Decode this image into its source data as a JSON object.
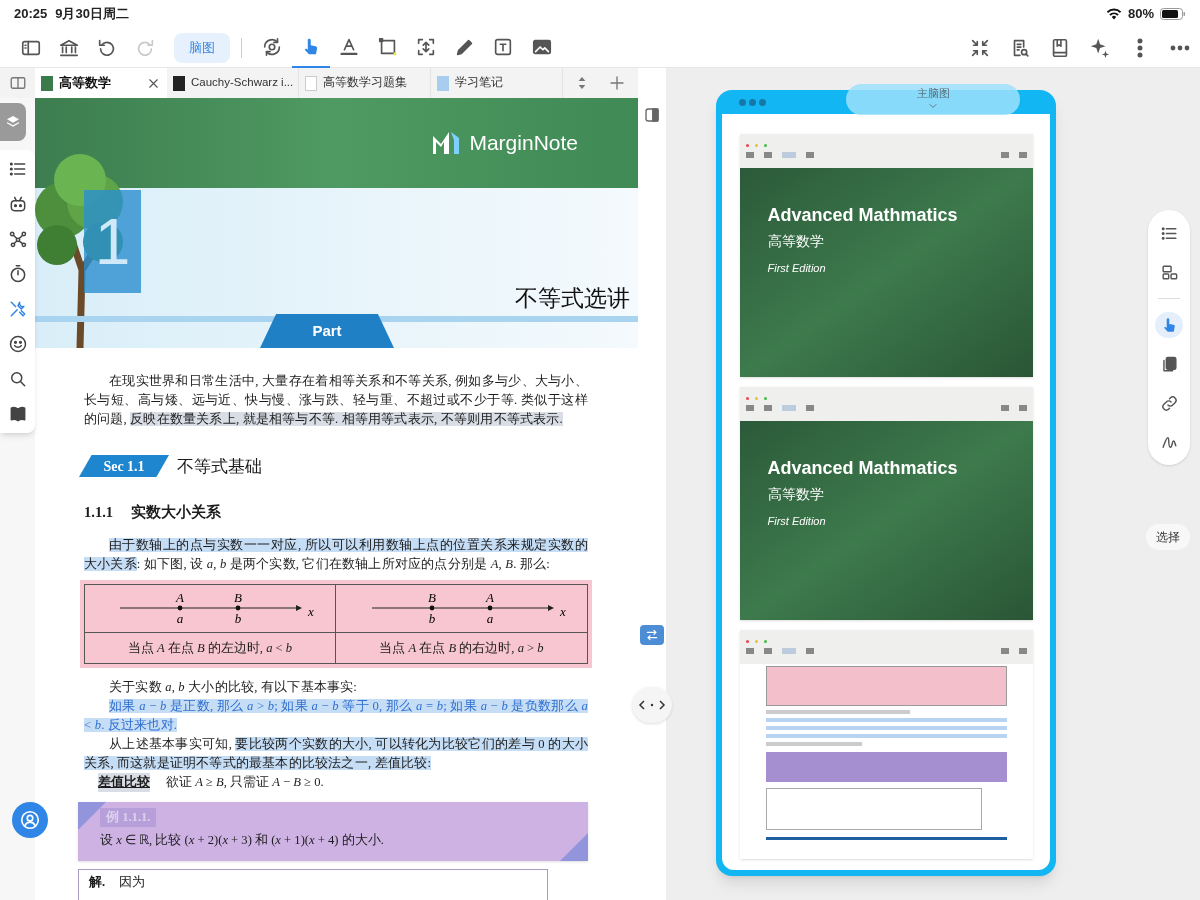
{
  "status_bar": {
    "time": "20:25",
    "date": "9月30日周二",
    "battery": "80%"
  },
  "toolbar": {
    "nav": [
      {
        "kind": "sidebar",
        "disabled": false
      },
      {
        "kind": "library",
        "disabled": false
      },
      {
        "kind": "undo",
        "disabled": false
      },
      {
        "kind": "redo",
        "disabled": true
      }
    ],
    "mindmap_button": {
      "label": "脑图",
      "selected": true
    },
    "tools": [
      {
        "kind": "sync",
        "selected": false
      },
      {
        "kind": "hand",
        "selected": true
      },
      {
        "kind": "textmark",
        "selected": false
      },
      {
        "kind": "rect",
        "selected": false
      },
      {
        "kind": "crop",
        "selected": false
      },
      {
        "kind": "pen",
        "selected": false
      },
      {
        "kind": "textbox",
        "selected": false
      },
      {
        "kind": "image",
        "selected": false
      }
    ]
  },
  "tabs": [
    {
      "label": "高等数学",
      "kind": "book",
      "selected": true
    },
    {
      "label": "Cauchy-Schwarz i...",
      "kind": "video",
      "selected": false
    },
    {
      "label": "高等数学习题集",
      "kind": "doc",
      "selected": false
    },
    {
      "label": "学习笔记",
      "kind": "notebook",
      "selected": false
    }
  ],
  "left_tools": [
    {
      "kind": "list",
      "selected": false
    },
    {
      "kind": "robot",
      "selected": false
    },
    {
      "kind": "nodes",
      "selected": false
    },
    {
      "kind": "timer",
      "selected": false
    },
    {
      "kind": "tools",
      "selected": true
    },
    {
      "kind": "smiley",
      "selected": false
    },
    {
      "kind": "search",
      "selected": false
    },
    {
      "kind": "book2",
      "selected": false
    }
  ],
  "document": {
    "banner": {
      "logo": "MarginNote",
      "chapter_number": "1",
      "title": "不等式选讲",
      "part": "Part"
    },
    "blocks": [
      {
        "kind": "paragraph",
        "segments": [
          {
            "text": "在现实世界和日常生活中, 大量存在着相等关系和不等关系, 例如多与少、大与小、长与短、高与矮、远与近、快与慢、涨与跌、轻与重、不超过或不少于等. 类似于这样的问题, "
          },
          {
            "text": "反映在数量关系上, 就是相等与不等. 相等用等式表示, 不等则用不等式表示.",
            "color": "#d9dee6"
          }
        ]
      },
      {
        "kind": "section",
        "badge": "Sec 1.1",
        "title": "不等式基础"
      },
      {
        "kind": "subsection",
        "number": "1.1.1",
        "title": "实数大小关系"
      },
      {
        "kind": "paragraph",
        "segments": [
          {
            "text": "由于数轴上的点与实数一一对应, 所以可以利用数轴上点的位置关系来规定实数的大小关系",
            "color": "#c6ddf6"
          },
          {
            "text": ": 如下图, 设 *a*, *b* 是两个实数, 它们在数轴上所对应的点分别是 *A*, *B*. 那么:"
          }
        ]
      },
      {
        "kind": "number_table",
        "cells": [
          {
            "points": [
              {
                "upper": "A",
                "lower": "a"
              },
              {
                "upper": "B",
                "lower": "b"
              }
            ],
            "axis": "x",
            "caption": "当点 *A* 在点 *B* 的左边时, *a* < *b*"
          },
          {
            "points": [
              {
                "upper": "B",
                "lower": "b"
              },
              {
                "upper": "A",
                "lower": "a"
              }
            ],
            "axis": "x",
            "caption": "当点 *A* 在点 *B* 的右边时, *a* > *b*"
          }
        ]
      },
      {
        "kind": "paragraph",
        "segments": [
          {
            "text": "关于实数 *a*, *b* 大小的比较, 有以下基本事实:"
          }
        ]
      },
      {
        "kind": "paragraph",
        "segments": [
          {
            "text": "如果 *a* − *b* 是正数, 那么 *a* > *b*; 如果 *a* − *b* 等于 0, 那么 *a* = *b*; 如果 *a* − *b* 是负数那么 *a* < *b*. 反过来也对.",
            "color": "#c6ddf6",
            "text_style": {
              "color": "#2f6fd0"
            }
          }
        ]
      },
      {
        "kind": "paragraph",
        "segments": [
          {
            "text": "从上述基本事实可知, "
          },
          {
            "text": "要比较两个实数的大小, 可以转化为比较它们的差与 0 的大小关系, 而这就是证明不等式的最基本的比较法之一, 差值比较:",
            "color": "#c6ddf6"
          }
        ]
      },
      {
        "kind": "definition",
        "term": "差值比较",
        "color": "#d9dee6",
        "text": "欲证 *A* ≥ *B*, 只需证 *A* − *B* ≥ 0."
      },
      {
        "kind": "example",
        "label": "例 1.1.1.",
        "text": "设 *x* ∈ ℝ, 比较 (*x* + 2)(*x* + 3) 和 (*x* + 1)(*x* + 4) 的大小."
      },
      {
        "kind": "solution",
        "label": "解.",
        "text": "因为"
      }
    ]
  },
  "mindmap": {
    "title": "主脑图",
    "cards": [
      {
        "kind": "cover",
        "title": "Advanced Mathmatics",
        "subtitle": "高等数学",
        "edition": "First Edition"
      },
      {
        "kind": "cover",
        "title": "Advanced Mathmatics",
        "subtitle": "高等数学",
        "edition": "First Edition"
      },
      {
        "kind": "page"
      }
    ]
  },
  "right_tools": [
    {
      "kind": "list",
      "selected": false
    },
    {
      "kind": "layout",
      "selected": false
    },
    {
      "kind": "hand",
      "selected": true
    },
    {
      "kind": "copy",
      "selected": false
    },
    {
      "kind": "link",
      "selected": false
    },
    {
      "kind": "squiggle",
      "selected": false
    }
  ],
  "select_label": "选择"
}
